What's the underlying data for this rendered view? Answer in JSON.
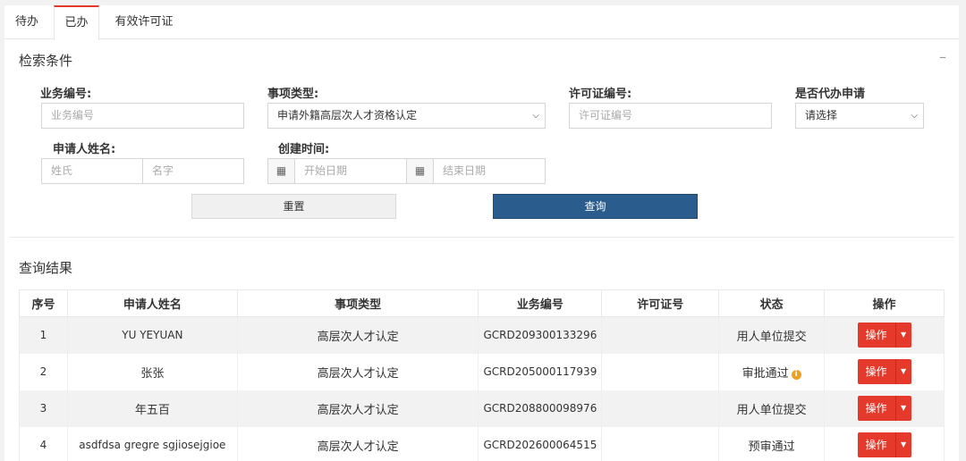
{
  "tabs": [
    {
      "label": "待办"
    },
    {
      "label": "已办"
    },
    {
      "label": "有效许可证"
    }
  ],
  "search": {
    "title": "检索条件",
    "collapse": "–",
    "fields": {
      "business_no": {
        "label": "业务编号:",
        "placeholder": "业务编号"
      },
      "item_type": {
        "label": "事项类型:",
        "value": "申请外籍高层次人才资格认定"
      },
      "license_no": {
        "label": "许可证编号:",
        "placeholder": "许可证编号"
      },
      "proxy": {
        "label": "是否代办申请",
        "value": "请选择"
      },
      "applicant": {
        "label": "申请人姓名:",
        "last_placeholder": "姓氏",
        "first_placeholder": "名字"
      },
      "created": {
        "label": "创建时间:",
        "start_placeholder": "开始日期",
        "end_placeholder": "结束日期"
      }
    },
    "reset_label": "重置",
    "search_label": "查询"
  },
  "results": {
    "title": "查询结果",
    "columns": [
      "序号",
      "申请人姓名",
      "事项类型",
      "业务编号",
      "许可证号",
      "状态",
      "操作"
    ],
    "rows": [
      {
        "no": "1",
        "name": "YU YEYUAN",
        "type": "高层次人才认定",
        "biz": "GCRD209300133296",
        "license": "",
        "status": "用人单位提交",
        "op": "操作"
      },
      {
        "no": "2",
        "name": "张张",
        "type": "高层次人才认定",
        "biz": "GCRD205000117939",
        "license": "",
        "status": "审批通过",
        "info": "i",
        "op": "操作"
      },
      {
        "no": "3",
        "name": "年五百",
        "type": "高层次人才认定",
        "biz": "GCRD208800098976",
        "license": "",
        "status": "用人单位提交",
        "op": "操作"
      },
      {
        "no": "4",
        "name": "asdfdsa gregre sgjiosejgioe",
        "type": "高层次人才认定",
        "biz": "GCRD202600064515",
        "license": "",
        "status": "预审通过",
        "op": "操作"
      }
    ]
  }
}
